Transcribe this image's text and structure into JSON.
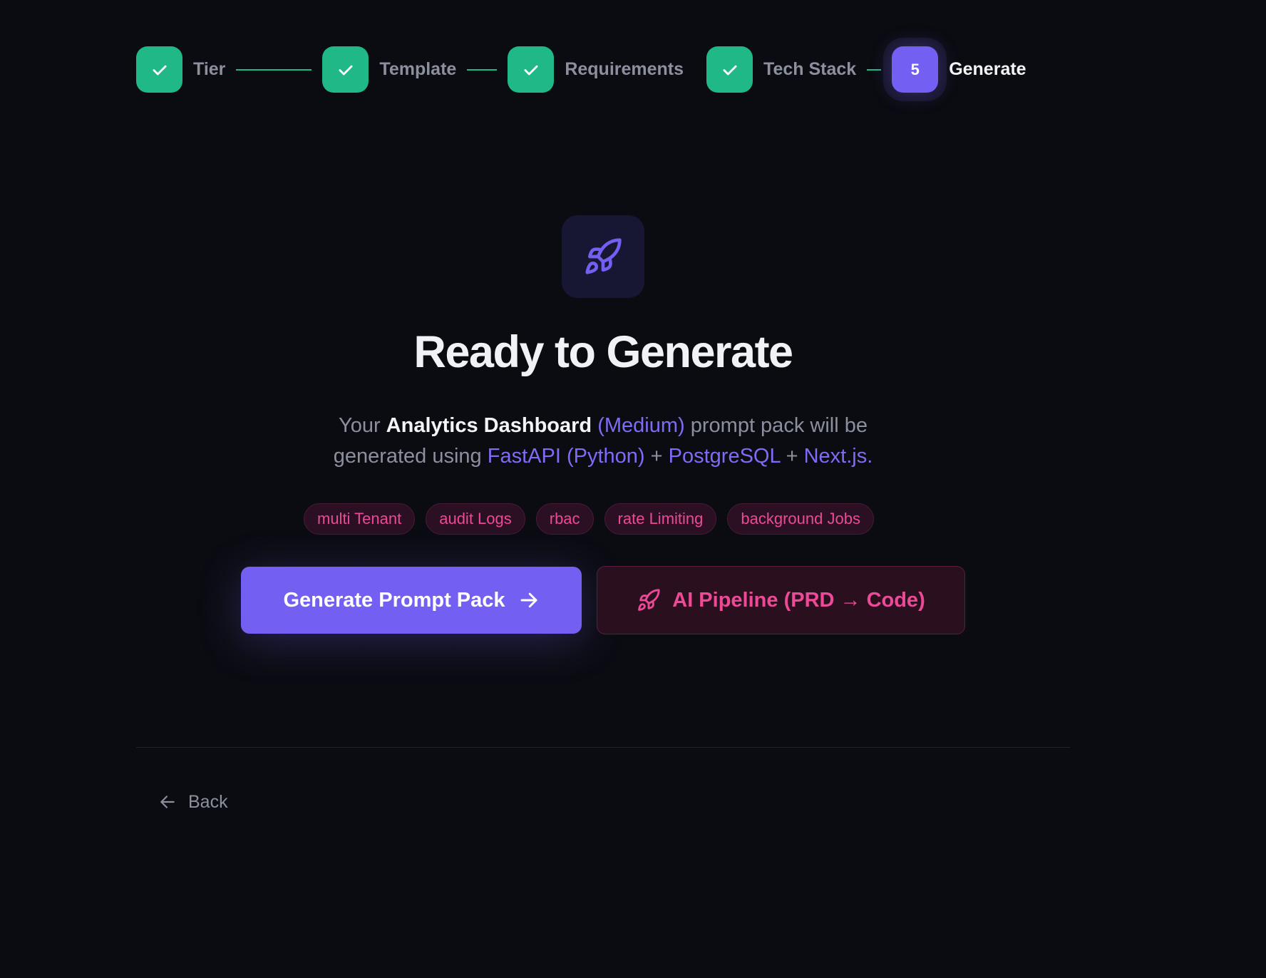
{
  "stepper": {
    "steps": [
      {
        "label": "Tier",
        "state": "complete",
        "icon": "check-icon"
      },
      {
        "label": "Template",
        "state": "complete",
        "icon": "check-icon"
      },
      {
        "label": "Requirements",
        "state": "complete",
        "icon": "check-icon"
      },
      {
        "label": "Tech Stack",
        "state": "complete",
        "icon": "check-icon"
      },
      {
        "label": "Generate",
        "state": "current",
        "number": "5"
      }
    ]
  },
  "hero": {
    "icon": "rocket-icon",
    "title": "Ready to Generate",
    "description": {
      "prefix": "Your ",
      "template": "Analytics Dashboard",
      "tier": "(Medium)",
      "mid": " prompt pack will be generated using ",
      "stack": [
        "FastAPI (Python)",
        "PostgreSQL",
        "Next.js"
      ],
      "separator": " + ",
      "suffix": "."
    }
  },
  "features": [
    "multi Tenant",
    "audit Logs",
    "rbac",
    "rate Limiting",
    "background Jobs"
  ],
  "actions": {
    "primary_label": "Generate Prompt Pack",
    "primary_icon": "arrow-right-icon",
    "secondary_label": "AI Pipeline (PRD → Code)",
    "secondary_icon": "rocket-icon"
  },
  "footer": {
    "back_label": "Back",
    "back_icon": "arrow-left-icon"
  },
  "colors": {
    "background": "#0b0c12",
    "complete": "#20b886",
    "primary": "#7360f2",
    "pink": "#ec4a96",
    "muted": "#8c8f9e"
  }
}
